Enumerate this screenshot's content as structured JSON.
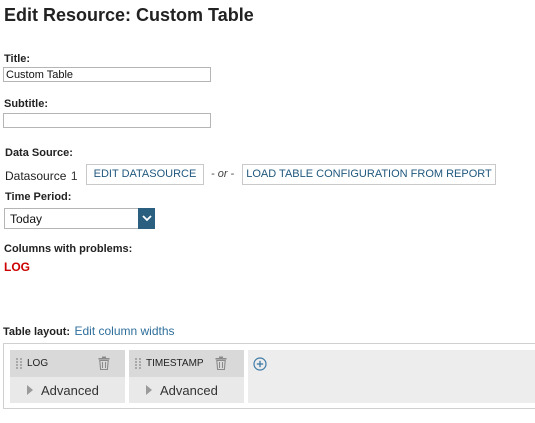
{
  "page": {
    "title": "Edit Resource: Custom Table"
  },
  "form": {
    "title_label": "Title:",
    "title_value": "Custom Table",
    "subtitle_label": "Subtitle:",
    "subtitle_value": "",
    "datasource_label": "Data Source:",
    "datasource_name": "Datasource",
    "datasource_number": "1",
    "edit_datasource_button": "EDIT DATASOURCE",
    "or_text": "- or -",
    "load_config_button": "LOAD TABLE CONFIGURATION FROM REPORT",
    "time_period_label": "Time Period:",
    "time_period_value": "Today",
    "problems_label": "Columns with problems:",
    "problems_value": "LOG"
  },
  "layout": {
    "label": "Table layout:",
    "edit_widths_link": "Edit column widths",
    "columns": [
      {
        "name": "LOG",
        "advanced_label": "Advanced"
      },
      {
        "name": "TIMESTAMP",
        "advanced_label": "Advanced"
      }
    ]
  },
  "colors": {
    "accent": "#2b5f80",
    "link": "#2f6f9c",
    "error": "#cc0000",
    "button_text": "#20587e"
  },
  "icons": {
    "select_arrow": "chevron-down-icon",
    "column_grip": "drag-handle-icon",
    "column_delete": "trash-icon",
    "expand": "caret-right-icon",
    "add_column": "plus-circle-icon"
  }
}
